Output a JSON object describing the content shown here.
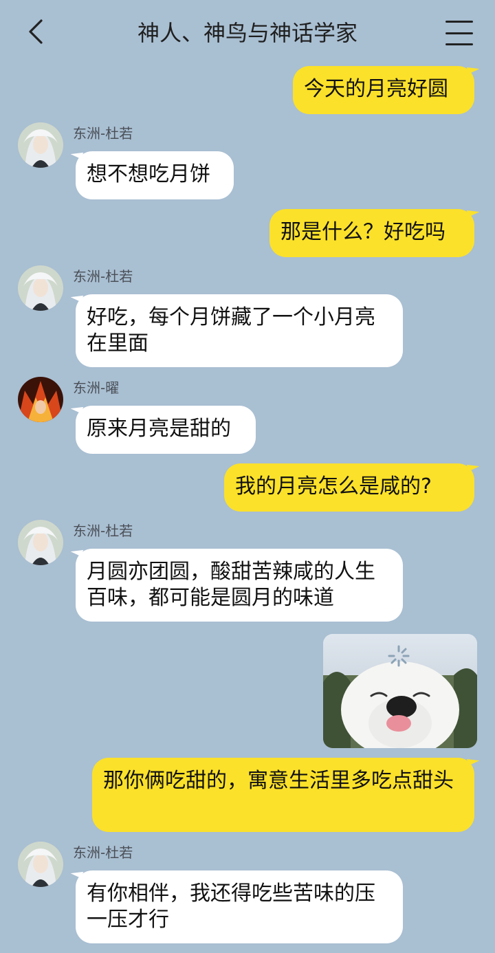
{
  "header": {
    "title": "神人、神鸟与神话学家"
  },
  "senders": {
    "duruo": "东洲-杜若",
    "yao": "东洲-曜"
  },
  "messages": {
    "m1": "今天的月亮好圆",
    "m2": "想不想吃月饼",
    "m3": "那是什么？好吃吗",
    "m4": "好吃，每个月饼藏了一个小月亮在里面",
    "m5": "原来月亮是甜的",
    "m6": "我的月亮怎么是咸的?",
    "m7": "月圆亦团圆，酸甜苦辣咸的人生百味，都可能是圆月的味道",
    "m9": "那你俩吃甜的，寓意生活里多吃点甜头",
    "m10": "有你相伴，我还得吃些苦味的压一压才行"
  },
  "colors": {
    "background": "#a9bfd2",
    "my_bubble": "#fbe12a",
    "other_bubble": "#ffffff"
  },
  "icons": {
    "back": "chevron-left-icon",
    "menu": "hamburger-menu-icon"
  }
}
